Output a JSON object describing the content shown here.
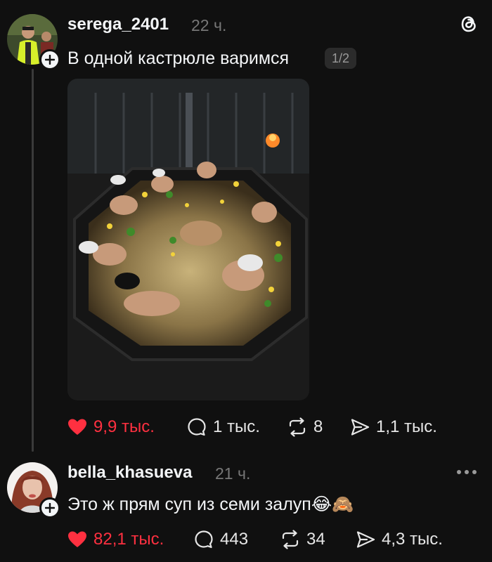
{
  "post": {
    "username": "serega_2401",
    "timestamp": "22 ч.",
    "text": "В одной кастрюле варимся",
    "media_counter": "1/2",
    "actions": {
      "likes": "9,9 тыс.",
      "comments": "1 тыс.",
      "reposts": "8",
      "shares": "1,1 тыс."
    },
    "liked": true
  },
  "reply": {
    "username": "bella_khasueva",
    "timestamp": "21 ч.",
    "text": "Это ж прям суп из семи залуп",
    "emojis": "😂🙈",
    "actions": {
      "likes": "82,1 тыс.",
      "comments": "443",
      "reposts": "34",
      "shares": "4,3 тыс."
    },
    "liked": true
  },
  "colors": {
    "background": "#101010",
    "text": "#f3f5f7",
    "muted": "#777777",
    "like": "#ff3040",
    "thread_line": "#3a3a3a"
  },
  "icons": [
    "threads-logo-icon",
    "plus-icon",
    "heart-icon",
    "comment-icon",
    "repost-icon",
    "share-icon",
    "more-icon"
  ]
}
